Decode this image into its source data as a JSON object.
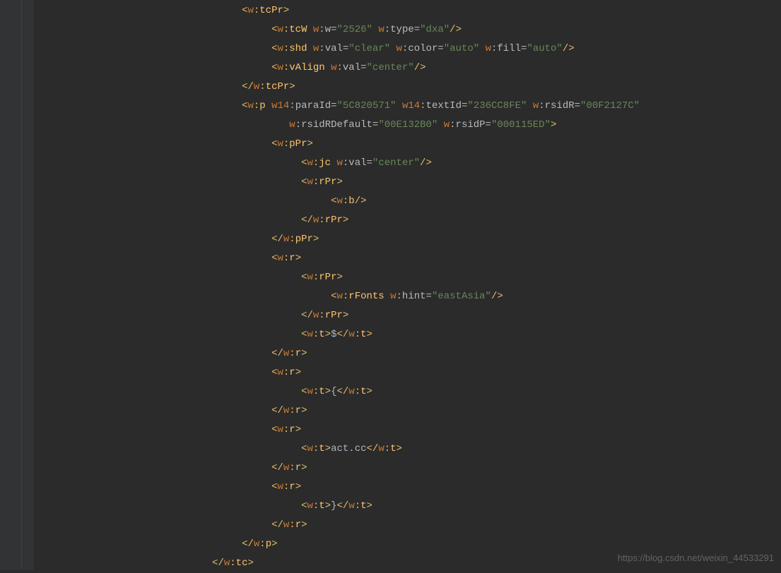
{
  "watermark": "https://blog.csdn.net/weixin_44533291",
  "indent_unit": "    ",
  "base_indent": 7,
  "lines": [
    {
      "i": 7,
      "t": [
        [
          "b",
          "<"
        ],
        [
          "p",
          "w"
        ],
        [
          "b",
          ":"
        ],
        [
          "t",
          "tcPr"
        ],
        [
          "b",
          ">"
        ]
      ]
    },
    {
      "i": 8,
      "t": [
        [
          "b",
          "<"
        ],
        [
          "p",
          "w"
        ],
        [
          "b",
          ":"
        ],
        [
          "t",
          "tcW "
        ],
        [
          "p",
          "w"
        ],
        [
          "a",
          ":w="
        ],
        [
          "v",
          "\"2526\" "
        ],
        [
          "p",
          "w"
        ],
        [
          "a",
          ":type="
        ],
        [
          "v",
          "\"dxa\""
        ],
        [
          "b",
          "/>"
        ]
      ]
    },
    {
      "i": 8,
      "t": [
        [
          "b",
          "<"
        ],
        [
          "p",
          "w"
        ],
        [
          "b",
          ":"
        ],
        [
          "t",
          "shd "
        ],
        [
          "p",
          "w"
        ],
        [
          "a",
          ":val="
        ],
        [
          "v",
          "\"clear\" "
        ],
        [
          "p",
          "w"
        ],
        [
          "a",
          ":color="
        ],
        [
          "v",
          "\"auto\" "
        ],
        [
          "p",
          "w"
        ],
        [
          "a",
          ":fill="
        ],
        [
          "v",
          "\"auto\""
        ],
        [
          "b",
          "/>"
        ]
      ]
    },
    {
      "i": 8,
      "t": [
        [
          "b",
          "<"
        ],
        [
          "p",
          "w"
        ],
        [
          "b",
          ":"
        ],
        [
          "t",
          "vAlign "
        ],
        [
          "p",
          "w"
        ],
        [
          "a",
          ":val="
        ],
        [
          "v",
          "\"center\""
        ],
        [
          "b",
          "/>"
        ]
      ]
    },
    {
      "i": 7,
      "t": [
        [
          "b",
          "</"
        ],
        [
          "p",
          "w"
        ],
        [
          "b",
          ":"
        ],
        [
          "t",
          "tcPr"
        ],
        [
          "b",
          ">"
        ]
      ]
    },
    {
      "i": 7,
      "t": [
        [
          "b",
          "<"
        ],
        [
          "p",
          "w"
        ],
        [
          "b",
          ":"
        ],
        [
          "t",
          "p "
        ],
        [
          "p",
          "w14"
        ],
        [
          "a",
          ":paraId="
        ],
        [
          "v",
          "\"5C820571\" "
        ],
        [
          "p",
          "w14"
        ],
        [
          "a",
          ":textId="
        ],
        [
          "v",
          "\"236CC8FE\" "
        ],
        [
          "p",
          "w"
        ],
        [
          "a",
          ":rsidR="
        ],
        [
          "v",
          "\"00F2127C\""
        ]
      ]
    },
    {
      "i": 8,
      "t": [
        [
          "c",
          "   "
        ],
        [
          "p",
          "w"
        ],
        [
          "a",
          ":rsidRDefault="
        ],
        [
          "v",
          "\"00E132B0\" "
        ],
        [
          "p",
          "w"
        ],
        [
          "a",
          ":rsidP="
        ],
        [
          "v",
          "\"000115ED\""
        ],
        [
          "b",
          ">"
        ]
      ]
    },
    {
      "i": 8,
      "t": [
        [
          "b",
          "<"
        ],
        [
          "p",
          "w"
        ],
        [
          "b",
          ":"
        ],
        [
          "t",
          "pPr"
        ],
        [
          "b",
          ">"
        ]
      ]
    },
    {
      "i": 9,
      "t": [
        [
          "b",
          "<"
        ],
        [
          "p",
          "w"
        ],
        [
          "b",
          ":"
        ],
        [
          "t",
          "jc "
        ],
        [
          "p",
          "w"
        ],
        [
          "a",
          ":val="
        ],
        [
          "v",
          "\"center\""
        ],
        [
          "b",
          "/>"
        ]
      ]
    },
    {
      "i": 9,
      "t": [
        [
          "b",
          "<"
        ],
        [
          "p",
          "w"
        ],
        [
          "b",
          ":"
        ],
        [
          "t",
          "rPr"
        ],
        [
          "b",
          ">"
        ]
      ]
    },
    {
      "i": 10,
      "t": [
        [
          "b",
          "<"
        ],
        [
          "p",
          "w"
        ],
        [
          "b",
          ":"
        ],
        [
          "t",
          "b"
        ],
        [
          "b",
          "/>"
        ]
      ]
    },
    {
      "i": 9,
      "t": [
        [
          "b",
          "</"
        ],
        [
          "p",
          "w"
        ],
        [
          "b",
          ":"
        ],
        [
          "t",
          "rPr"
        ],
        [
          "b",
          ">"
        ]
      ]
    },
    {
      "i": 8,
      "t": [
        [
          "b",
          "</"
        ],
        [
          "p",
          "w"
        ],
        [
          "b",
          ":"
        ],
        [
          "t",
          "pPr"
        ],
        [
          "b",
          ">"
        ]
      ]
    },
    {
      "i": 8,
      "t": [
        [
          "b",
          "<"
        ],
        [
          "p",
          "w"
        ],
        [
          "b",
          ":"
        ],
        [
          "t",
          "r"
        ],
        [
          "b",
          ">"
        ]
      ]
    },
    {
      "i": 9,
      "t": [
        [
          "b",
          "<"
        ],
        [
          "p",
          "w"
        ],
        [
          "b",
          ":"
        ],
        [
          "t",
          "rPr"
        ],
        [
          "b",
          ">"
        ]
      ]
    },
    {
      "i": 10,
      "t": [
        [
          "b",
          "<"
        ],
        [
          "p",
          "w"
        ],
        [
          "b",
          ":"
        ],
        [
          "t",
          "rFonts "
        ],
        [
          "p",
          "w"
        ],
        [
          "a",
          ":hint="
        ],
        [
          "v",
          "\"eastAsia\""
        ],
        [
          "b",
          "/>"
        ]
      ]
    },
    {
      "i": 9,
      "t": [
        [
          "b",
          "</"
        ],
        [
          "p",
          "w"
        ],
        [
          "b",
          ":"
        ],
        [
          "t",
          "rPr"
        ],
        [
          "b",
          ">"
        ]
      ]
    },
    {
      "i": 9,
      "t": [
        [
          "b",
          "<"
        ],
        [
          "p",
          "w"
        ],
        [
          "b",
          ":"
        ],
        [
          "t",
          "t"
        ],
        [
          "b",
          ">"
        ],
        [
          "c",
          "$"
        ],
        [
          "b",
          "</"
        ],
        [
          "p",
          "w"
        ],
        [
          "b",
          ":"
        ],
        [
          "t",
          "t"
        ],
        [
          "b",
          ">"
        ]
      ]
    },
    {
      "i": 8,
      "t": [
        [
          "b",
          "</"
        ],
        [
          "p",
          "w"
        ],
        [
          "b",
          ":"
        ],
        [
          "t",
          "r"
        ],
        [
          "b",
          ">"
        ]
      ]
    },
    {
      "i": 8,
      "t": [
        [
          "b",
          "<"
        ],
        [
          "p",
          "w"
        ],
        [
          "b",
          ":"
        ],
        [
          "t",
          "r"
        ],
        [
          "b",
          ">"
        ]
      ]
    },
    {
      "i": 9,
      "t": [
        [
          "b",
          "<"
        ],
        [
          "p",
          "w"
        ],
        [
          "b",
          ":"
        ],
        [
          "t",
          "t"
        ],
        [
          "b",
          ">"
        ],
        [
          "c",
          "{"
        ],
        [
          "b",
          "</"
        ],
        [
          "p",
          "w"
        ],
        [
          "b",
          ":"
        ],
        [
          "t",
          "t"
        ],
        [
          "b",
          ">"
        ]
      ]
    },
    {
      "i": 8,
      "t": [
        [
          "b",
          "</"
        ],
        [
          "p",
          "w"
        ],
        [
          "b",
          ":"
        ],
        [
          "t",
          "r"
        ],
        [
          "b",
          ">"
        ]
      ]
    },
    {
      "i": 8,
      "t": [
        [
          "b",
          "<"
        ],
        [
          "p",
          "w"
        ],
        [
          "b",
          ":"
        ],
        [
          "t",
          "r"
        ],
        [
          "b",
          ">"
        ]
      ]
    },
    {
      "i": 9,
      "t": [
        [
          "b",
          "<"
        ],
        [
          "p",
          "w"
        ],
        [
          "b",
          ":"
        ],
        [
          "t",
          "t"
        ],
        [
          "b",
          ">"
        ],
        [
          "c",
          "act.cc"
        ],
        [
          "b",
          "</"
        ],
        [
          "p",
          "w"
        ],
        [
          "b",
          ":"
        ],
        [
          "t",
          "t"
        ],
        [
          "b",
          ">"
        ]
      ]
    },
    {
      "i": 8,
      "t": [
        [
          "b",
          "</"
        ],
        [
          "p",
          "w"
        ],
        [
          "b",
          ":"
        ],
        [
          "t",
          "r"
        ],
        [
          "b",
          ">"
        ]
      ]
    },
    {
      "i": 8,
      "t": [
        [
          "b",
          "<"
        ],
        [
          "p",
          "w"
        ],
        [
          "b",
          ":"
        ],
        [
          "t",
          "r"
        ],
        [
          "b",
          ">"
        ]
      ]
    },
    {
      "i": 9,
      "t": [
        [
          "b",
          "<"
        ],
        [
          "p",
          "w"
        ],
        [
          "b",
          ":"
        ],
        [
          "t",
          "t"
        ],
        [
          "b",
          ">"
        ],
        [
          "c",
          "}"
        ],
        [
          "b",
          "</"
        ],
        [
          "p",
          "w"
        ],
        [
          "b",
          ":"
        ],
        [
          "t",
          "t"
        ],
        [
          "b",
          ">"
        ]
      ]
    },
    {
      "i": 8,
      "t": [
        [
          "b",
          "</"
        ],
        [
          "p",
          "w"
        ],
        [
          "b",
          ":"
        ],
        [
          "t",
          "r"
        ],
        [
          "b",
          ">"
        ]
      ]
    },
    {
      "i": 7,
      "t": [
        [
          "b",
          "</"
        ],
        [
          "p",
          "w"
        ],
        [
          "b",
          ":"
        ],
        [
          "t",
          "p"
        ],
        [
          "b",
          ">"
        ]
      ]
    },
    {
      "i": 6,
      "t": [
        [
          "b",
          "</"
        ],
        [
          "p",
          "w"
        ],
        [
          "b",
          ":"
        ],
        [
          "t",
          "tc"
        ],
        [
          "b",
          ">"
        ]
      ]
    }
  ]
}
